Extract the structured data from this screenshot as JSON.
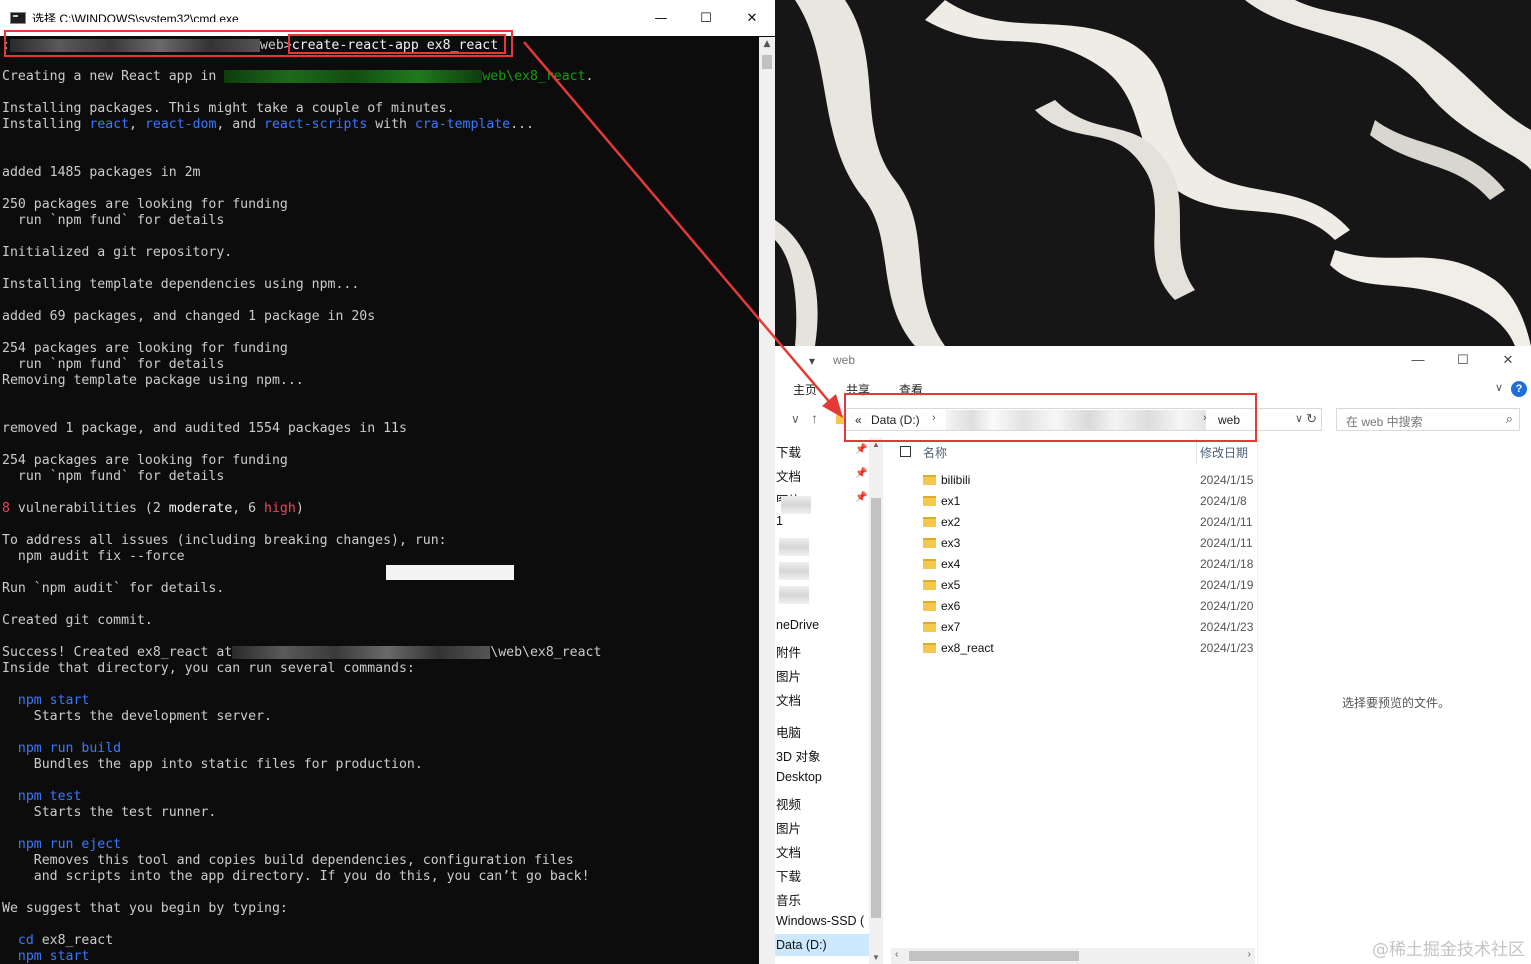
{
  "cmd": {
    "title": "选择 C:\\WINDOWS\\system32\\cmd.exe",
    "controls": {
      "minimize": "—",
      "maximize": "☐",
      "close": "✕"
    },
    "prompt_prefix": ":",
    "prompt_dir": "web",
    "prompt_symbol": ">",
    "command": "create-react-app ex8_react",
    "lines": {
      "creating_prefix": "Creating a new React app in ",
      "creating_path": "web\\ex8_react",
      "creating_end": ".",
      "installing_1": "Installing packages. This might take a couple of minutes.",
      "installing_2_pre": "Installing ",
      "pkg_react": "react",
      "comma": ", ",
      "pkg_react_dom": "react-dom",
      "and": ", and ",
      "pkg_scripts": "react-scripts",
      "with": " with ",
      "pkg_template": "cra-template",
      "ellipsis": "...",
      "added_1485": "added 1485 packages in 2m",
      "funding_250": "250 packages are looking for funding",
      "npm_fund_1": "  run `npm fund` for details",
      "git_init": "Initialized a git repository.",
      "template_deps": "Installing template dependencies using npm...",
      "added_69": "added 69 packages, and changed 1 package in 20s",
      "funding_254_a": "254 packages are looking for funding",
      "npm_fund_2": "  run `npm fund` for details",
      "removing_template": "Removing template package using npm...",
      "removed": "removed 1 package, and audited 1554 packages in 11s",
      "funding_254_b": "254 packages are looking for funding",
      "npm_fund_3": "  run `npm fund` for details",
      "vuln_count": "8",
      "vuln_text_1": " vulnerabilities (2 ",
      "vuln_moderate": "moderate",
      "vuln_text_2": ", 6 ",
      "vuln_high": "high",
      "vuln_text_3": ")",
      "address_issues": "To address all issues (including breaking changes), run:",
      "audit_fix": "  npm audit fix --force",
      "run_audit": "Run `npm audit` for details.",
      "created_commit": "Created git commit.",
      "success_prefix": "Success! Created ex8_react at",
      "success_path": "\\web\\ex8_react",
      "inside_dir": "Inside that directory, you can run several commands:",
      "cmd_start": "  npm start",
      "desc_start": "    Starts the development server.",
      "cmd_build": "  npm run build",
      "desc_build": "    Bundles the app into static files for production.",
      "cmd_test": "  npm test",
      "desc_test": "    Starts the test runner.",
      "cmd_eject": "  npm run eject",
      "desc_eject_1": "    Removes this tool and copies build dependencies, configuration files",
      "desc_eject_2": "    and scripts into the app directory. If you do this, you can’t go back!",
      "suggest": "We suggest that you begin by typing:",
      "cd_kw": "  cd",
      "cd_arg": " ex8_react",
      "final_start": "  npm start"
    }
  },
  "explorer": {
    "quick_access_caret": "▾",
    "window_title": "web",
    "controls": {
      "minimize": "—",
      "maximize": "☐",
      "close": "✕"
    },
    "ribbon_tabs": [
      "主页",
      "共享",
      "查看"
    ],
    "help": "?",
    "collapse": "∨",
    "nav": {
      "back": "∨",
      "up": "↑"
    },
    "address": {
      "lead": "«",
      "drive": "Data (D:)",
      "sep": "›",
      "folder": "web",
      "dropdown": "∨",
      "refresh": "↻"
    },
    "search_placeholder": "在 web 中搜索",
    "search_icon": "⌕",
    "nav_items": [
      "下载",
      "文档",
      "图片",
      "1",
      "neDrive",
      "附件",
      "图片",
      "文档",
      "电脑",
      "3D 对象",
      "Desktop",
      "视频",
      "图片",
      "文档",
      "下载",
      "音乐",
      "Windows-SSD (",
      "Data (D:)"
    ],
    "pin": "📌",
    "columns": {
      "name": "名称",
      "date": "修改日期"
    },
    "files": [
      {
        "name": "bilibili",
        "date": "2024/1/15"
      },
      {
        "name": "ex1",
        "date": "2024/1/8"
      },
      {
        "name": "ex2",
        "date": "2024/1/11"
      },
      {
        "name": "ex3",
        "date": "2024/1/11"
      },
      {
        "name": "ex4",
        "date": "2024/1/18"
      },
      {
        "name": "ex5",
        "date": "2024/1/19"
      },
      {
        "name": "ex6",
        "date": "2024/1/20"
      },
      {
        "name": "ex7",
        "date": "2024/1/23"
      },
      {
        "name": "ex8_react",
        "date": "2024/1/23"
      }
    ],
    "preview_text": "选择要预览的文件。",
    "hscroll": {
      "left": "‹",
      "right": "›"
    }
  },
  "watermark": "@稀土掘金技术社区",
  "colors": {
    "annotation": "#e53935",
    "terminal_bg": "#0c0c0c",
    "green": "#13a10e",
    "blue": "#3b78ff",
    "red": "#e74856"
  }
}
